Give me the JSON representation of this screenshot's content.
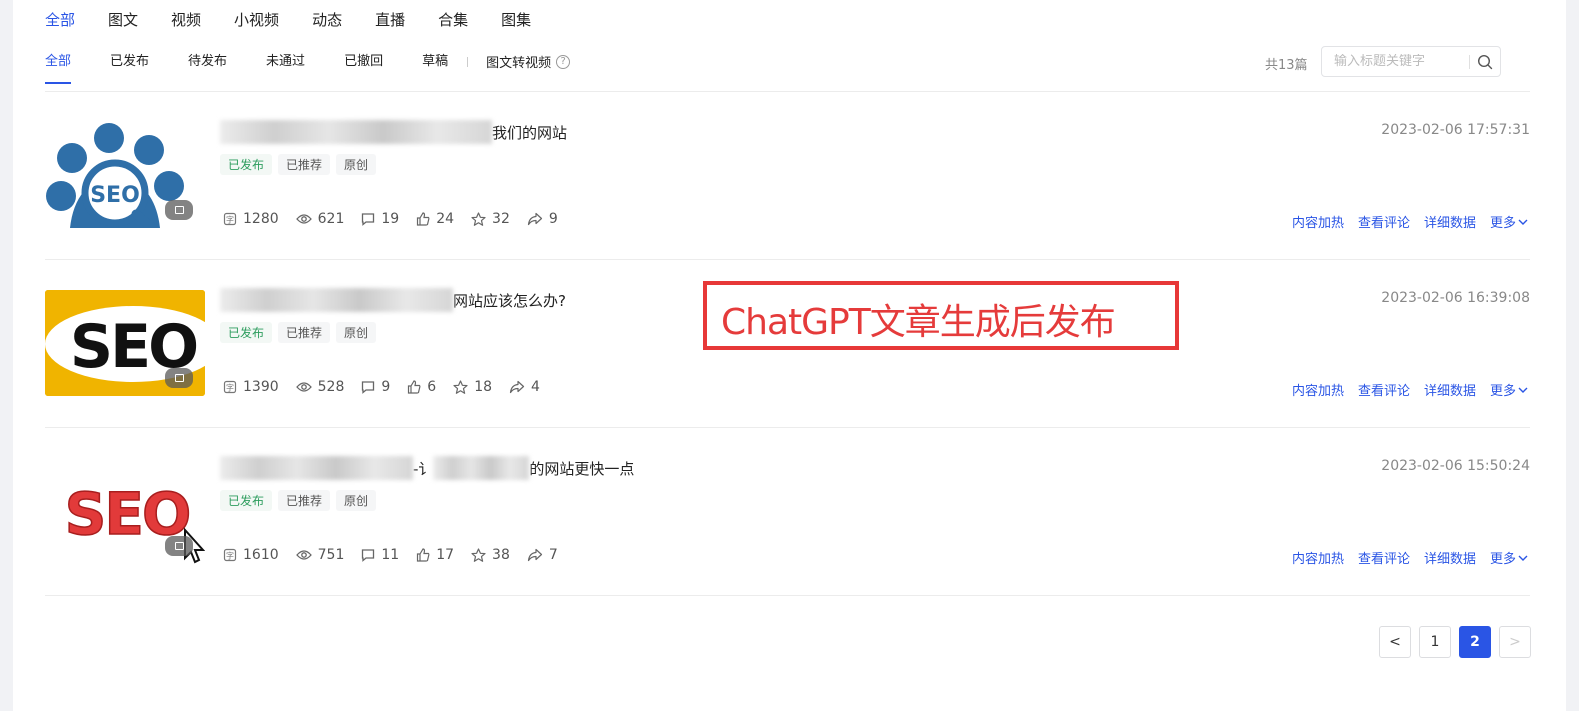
{
  "top_tabs": [
    "全部",
    "图文",
    "视频",
    "小视频",
    "动态",
    "直播",
    "合集",
    "图集"
  ],
  "sub_tabs": [
    "全部",
    "已发布",
    "待发布",
    "未通过",
    "已撤回",
    "草稿"
  ],
  "sub_extra": "图文转视频",
  "total": "共13篇",
  "search_placeholder": "输入标题关键字",
  "articles": [
    {
      "title_suffix": "我们的网站",
      "tags": [
        "已发布",
        "已推荐",
        "原创"
      ],
      "stats": {
        "chars": "1280",
        "views": "621",
        "comments": "19",
        "likes": "24",
        "favs": "32",
        "shares": "9"
      },
      "date": "2023-02-06 17:57:31",
      "thumb_text": "SEO"
    },
    {
      "title_suffix": "网站应该怎么办?",
      "tags": [
        "已发布",
        "已推荐",
        "原创"
      ],
      "stats": {
        "chars": "1390",
        "views": "528",
        "comments": "9",
        "likes": "6",
        "favs": "18",
        "shares": "4"
      },
      "date": "2023-02-06 16:39:08",
      "thumb_text": "SEO"
    },
    {
      "title_mid": "-讠",
      "title_suffix": "的网站更快一点",
      "tags": [
        "已发布",
        "已推荐",
        "原创"
      ],
      "stats": {
        "chars": "1610",
        "views": "751",
        "comments": "11",
        "likes": "17",
        "favs": "38",
        "shares": "7"
      },
      "date": "2023-02-06 15:50:24",
      "thumb_text": "SEO"
    }
  ],
  "actions": [
    "内容加热",
    "查看评论",
    "详细数据",
    "更多"
  ],
  "overlay_text": "ChatGPT文章生成后发布",
  "pagination": {
    "pages": [
      "1",
      "2"
    ],
    "current": "2",
    "prev": "<",
    "next": ">"
  },
  "colors": {
    "accent": "#2a55e5",
    "published": "#2e9d5e",
    "overlay": "#e73838"
  }
}
